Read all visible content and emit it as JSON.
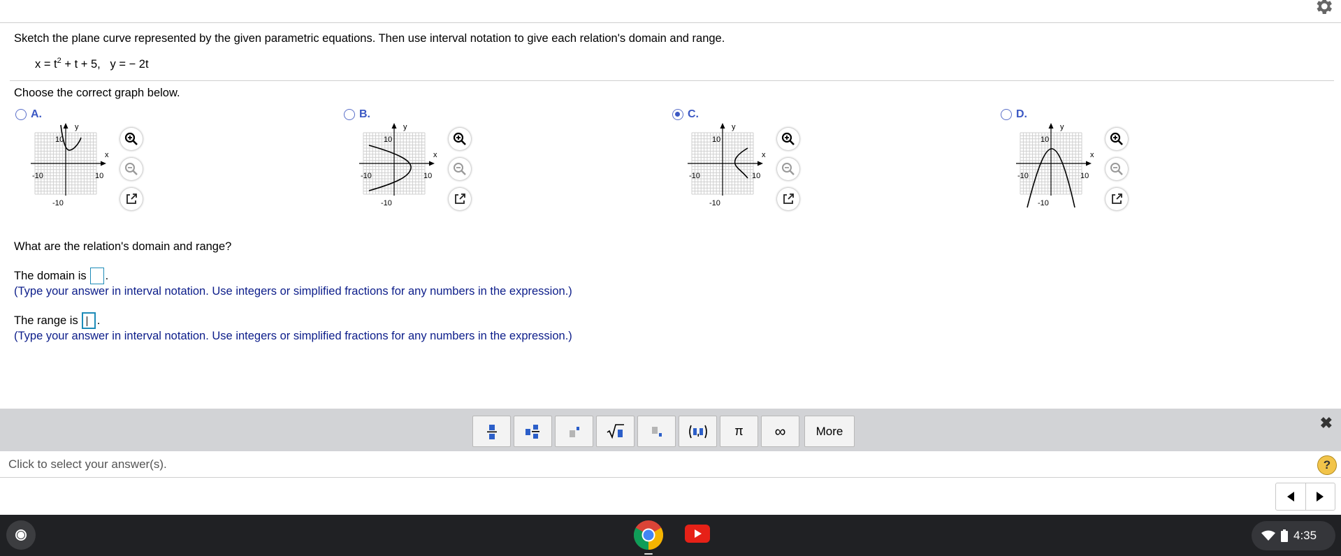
{
  "question": {
    "prompt": "Sketch the plane curve represented by the given parametric equations.  Then use interval notation to give each relation's domain and range.",
    "eq_x_pre": "x = t",
    "eq_x_exp": "2",
    "eq_x_post": " + t + 5,",
    "eq_y": "y =  − 2t",
    "choose": "Choose the correct graph below."
  },
  "options": [
    {
      "letter": "A.",
      "selected": false
    },
    {
      "letter": "B.",
      "selected": false
    },
    {
      "letter": "C.",
      "selected": true
    },
    {
      "letter": "D.",
      "selected": false
    }
  ],
  "graph_labels": {
    "x": "x",
    "y": "y",
    "pos": "10",
    "neg": "-10"
  },
  "domain_range": {
    "question": "What are the relation's domain and range?",
    "domain_prefix": "The domain is",
    "range_prefix": "The range is",
    "period": ".",
    "domain_value": "",
    "range_value": "",
    "hint": "(Type your answer in interval notation.  Use integers or simplified fractions for any numbers in the expression.)"
  },
  "math_toolbar": {
    "buttons": [
      "fraction-icon",
      "mixed-number-icon",
      "exponent-icon",
      "sqrt-icon",
      "subscript-icon",
      "interval-icon",
      "π",
      "∞"
    ],
    "pi": "π",
    "infinity": "∞",
    "more_label": "More",
    "close": "✖"
  },
  "status": {
    "text": "Click to select your answer(s).",
    "help": "?"
  },
  "taskbar": {
    "time": "4:35"
  },
  "colors": {
    "accent": "#3b58c4",
    "hint": "#0c1d8a",
    "input_border": "#1d8bb8"
  }
}
